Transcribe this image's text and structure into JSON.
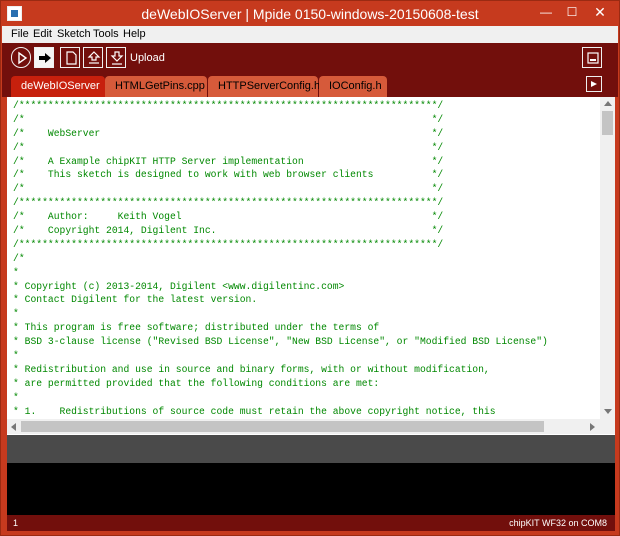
{
  "window": {
    "title": "deWebIOServer | Mpide 0150-windows-20150608-test",
    "controls": {
      "minimize": "—",
      "maximize": "☐",
      "close": "✕"
    }
  },
  "menu": [
    "File",
    "Edit",
    "Sketch",
    "Tools",
    "Help"
  ],
  "toolbar": {
    "buttons": [
      "verify-icon",
      "upload-icon",
      "new-icon",
      "open-icon",
      "save-icon",
      "serial-monitor-icon"
    ],
    "hover_label": "Upload"
  },
  "tabs": [
    {
      "label": "deWebIOServer",
      "active": true
    },
    {
      "label": "HTMLGetPins.cpp",
      "active": false
    },
    {
      "label": "HTTPServerConfig.h",
      "active": false
    },
    {
      "label": "IOConfig.h",
      "active": false
    }
  ],
  "code_lines": [
    "/************************************************************************/",
    "/*                                                                      */",
    "/*    WebServer                                                         */",
    "/*                                                                      */",
    "/*    A Example chipKIT HTTP Server implementation                      */",
    "/*    This sketch is designed to work with web browser clients          */",
    "/*                                                                      */",
    "/************************************************************************/",
    "/*    Author:     Keith Vogel                                           */",
    "/*    Copyright 2014, Digilent Inc.                                     */",
    "/************************************************************************/",
    "/*",
    "*",
    "* Copyright (c) 2013-2014, Digilent <www.digilentinc.com>",
    "* Contact Digilent for the latest version.",
    "*",
    "* This program is free software; distributed under the terms of",
    "* BSD 3-clause license (\"Revised BSD License\", \"New BSD License\", or \"Modified BSD License\")",
    "*",
    "* Redistribution and use in source and binary forms, with or without modification,",
    "* are permitted provided that the following conditions are met:",
    "*",
    "* 1.    Redistributions of source code must retain the above copyright notice, this"
  ],
  "status": {
    "line": "1",
    "board": "chipKIT WF32 on COM8"
  },
  "colors": {
    "title_bar": "#c63a1e",
    "toolbar": "#720f0c",
    "active_tab": "#c7200d",
    "inactive_tab": "#d65a3a",
    "code_comment": "#008800"
  }
}
